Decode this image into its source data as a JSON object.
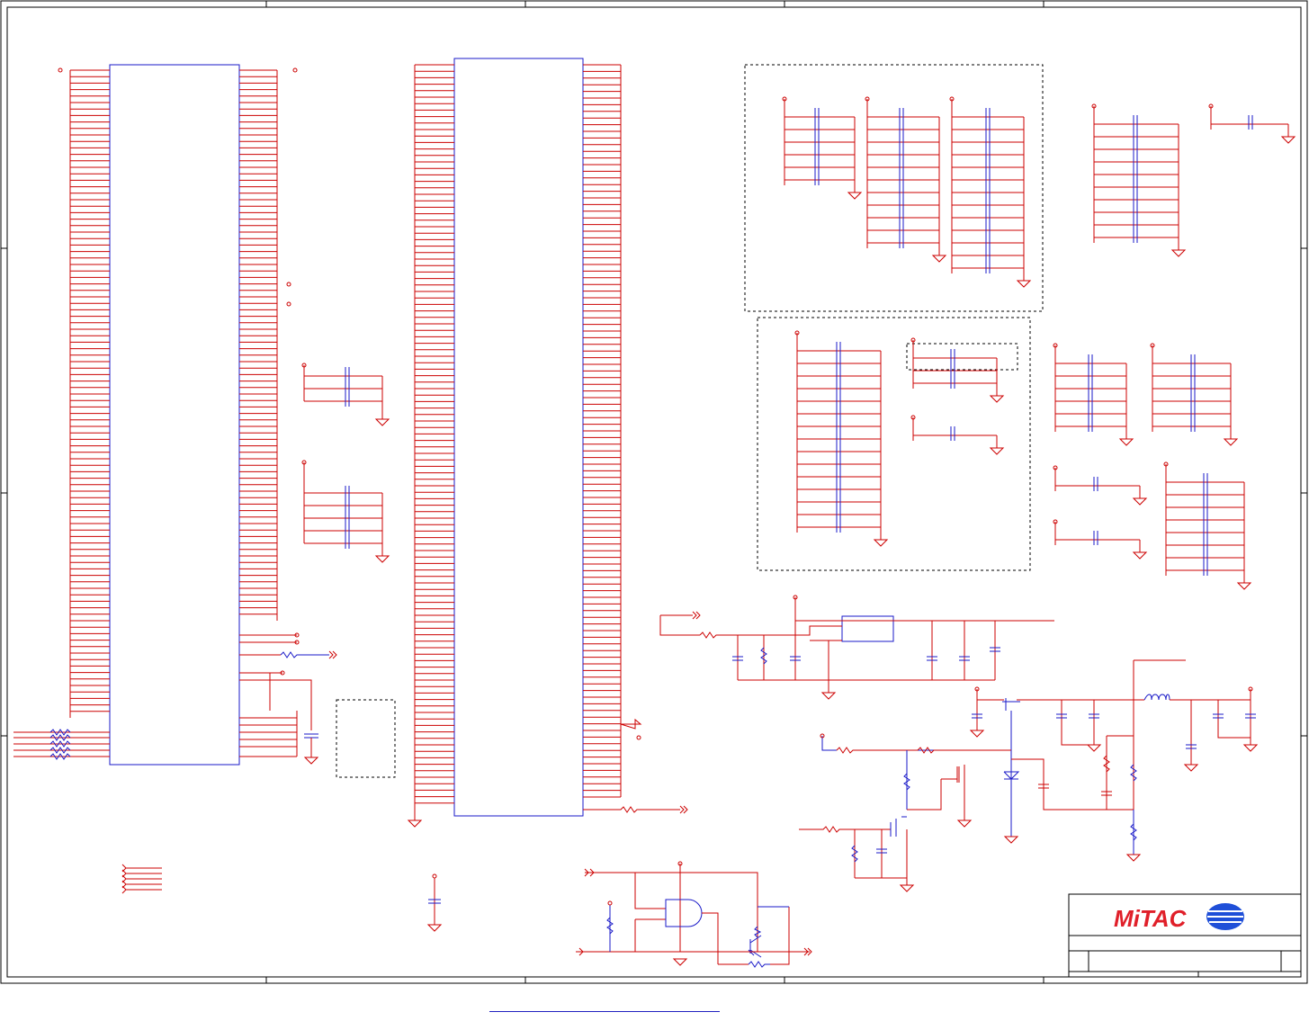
{
  "title_block": {
    "company_logo_text": "MiTAC"
  },
  "colors": {
    "wire": "#cc0000",
    "component": "#1a1ac8",
    "pin": "#b000b0",
    "frame": "#000000",
    "dashed_group": "#000000",
    "logo_red": "#e0202a",
    "logo_blue": "#1f4fd8"
  },
  "icons": [
    "ground-symbol-icon",
    "capacitor-icon",
    "resistor-icon",
    "inductor-icon",
    "mosfet-icon",
    "diode-icon",
    "and-gate-icon",
    "transistor-icon",
    "off-page-connector-icon",
    "mitac-globe-icon"
  ]
}
